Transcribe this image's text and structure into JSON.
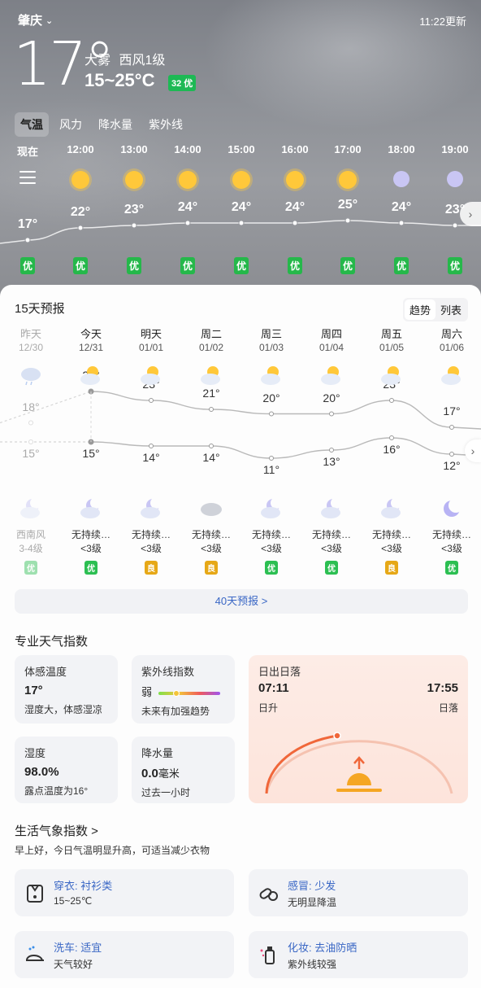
{
  "header": {
    "city": "肇庆",
    "update_time": "11:22更新",
    "current_temp": "17°",
    "condition": "大雾",
    "wind": "西风1级",
    "range": "15~25°C",
    "aqi": "32 优"
  },
  "tabs": [
    "气温",
    "风力",
    "降水量",
    "紫外线"
  ],
  "hourly": {
    "labels": [
      "现在",
      "12:00",
      "13:00",
      "14:00",
      "15:00",
      "16:00",
      "17:00",
      "18:00",
      "19:00"
    ],
    "icons": [
      "menu-icon",
      "sun-icon",
      "sun-icon",
      "sun-icon",
      "sun-icon",
      "sun-icon",
      "sun-icon",
      "moon-icon",
      "moon-icon"
    ],
    "temps": [
      "17°",
      "22°",
      "23°",
      "24°",
      "24°",
      "24°",
      "25°",
      "24°",
      "23°"
    ],
    "temp_values": [
      17,
      22,
      23,
      24,
      24,
      24,
      25,
      24,
      23
    ],
    "aqi": [
      "优",
      "优",
      "优",
      "优",
      "优",
      "优",
      "优",
      "优",
      "优"
    ]
  },
  "forecast": {
    "title": "15天预报",
    "toggle": [
      "趋势",
      "列表"
    ],
    "days": [
      {
        "name": "昨天",
        "date": "12/30",
        "day_icon": "cloud-rain-icon",
        "hi": "18°",
        "lo": "15°",
        "night_icon": "moon-cloud-icon",
        "wind1": "西南风",
        "wind2": "3-4级",
        "aqi": "优",
        "aqi_level": "good",
        "hi_value": 18,
        "lo_value": 15
      },
      {
        "name": "今天",
        "date": "12/31",
        "day_icon": "partly-sunny-icon",
        "hi": "25°",
        "lo": "15°",
        "night_icon": "moon-cloud-icon",
        "wind1": "无持续…",
        "wind2": "<3级",
        "aqi": "优",
        "aqi_level": "good",
        "hi_value": 25,
        "lo_value": 15
      },
      {
        "name": "明天",
        "date": "01/01",
        "day_icon": "partly-sunny-icon",
        "hi": "23°",
        "lo": "14°",
        "night_icon": "moon-cloud-icon",
        "wind1": "无持续…",
        "wind2": "<3级",
        "aqi": "良",
        "aqi_level": "ok",
        "hi_value": 23,
        "lo_value": 14
      },
      {
        "name": "周二",
        "date": "01/02",
        "day_icon": "partly-sunny-icon",
        "hi": "21°",
        "lo": "14°",
        "night_icon": "cloud-icon",
        "wind1": "无持续…",
        "wind2": "<3级",
        "aqi": "良",
        "aqi_level": "ok",
        "hi_value": 21,
        "lo_value": 14
      },
      {
        "name": "周三",
        "date": "01/03",
        "day_icon": "partly-sunny-icon",
        "hi": "20°",
        "lo": "11°",
        "night_icon": "moon-cloud-icon",
        "wind1": "无持续…",
        "wind2": "<3级",
        "aqi": "优",
        "aqi_level": "good",
        "hi_value": 20,
        "lo_value": 11
      },
      {
        "name": "周四",
        "date": "01/04",
        "day_icon": "partly-sunny-icon",
        "hi": "20°",
        "lo": "13°",
        "night_icon": "moon-cloud-icon",
        "wind1": "无持续…",
        "wind2": "<3级",
        "aqi": "优",
        "aqi_level": "good",
        "hi_value": 20,
        "lo_value": 13
      },
      {
        "name": "周五",
        "date": "01/05",
        "day_icon": "partly-sunny-icon",
        "hi": "23°",
        "lo": "16°",
        "night_icon": "moon-cloud-icon",
        "wind1": "无持续…",
        "wind2": "<3级",
        "aqi": "良",
        "aqi_level": "ok",
        "hi_value": 23,
        "lo_value": 16
      },
      {
        "name": "周六",
        "date": "01/06",
        "day_icon": "partly-sunny-icon",
        "hi": "17°",
        "lo": "12°",
        "night_icon": "moon-icon",
        "wind1": "无持续…",
        "wind2": "<3级",
        "aqi": "优",
        "aqi_level": "good",
        "hi_value": 17,
        "lo_value": 12
      }
    ],
    "more_label": "40天预报 >"
  },
  "pro": {
    "title": "专业天气指数",
    "feels": {
      "title": "体感温度",
      "value": "17°",
      "desc": "湿度大，体感湿凉"
    },
    "uv": {
      "title": "紫外线指数",
      "value": "弱",
      "desc": "未来有加强趋势"
    },
    "humidity": {
      "title": "湿度",
      "value": "98.0%",
      "desc": "露点温度为16°"
    },
    "rain": {
      "title": "降水量",
      "value": "0.0",
      "unit": "毫米",
      "desc": "过去一小时"
    },
    "sun": {
      "title": "日出日落",
      "sunrise": "07:11",
      "sunset": "17:55",
      "sunrise_label": "日升",
      "sunset_label": "日落"
    }
  },
  "life": {
    "title": "生活气象指数 >",
    "subtitle": "早上好，今日气温明显升高，可适当减少衣物",
    "items": [
      {
        "title": "穿衣: 衬衫类",
        "desc": "15~25℃",
        "icon": "shirt-icon"
      },
      {
        "title": "感冒: 少发",
        "desc": "无明显降温",
        "icon": "pills-icon"
      },
      {
        "title": "洗车: 适宜",
        "desc": "天气较好",
        "icon": "car-wash-icon"
      },
      {
        "title": "化妆: 去油防晒",
        "desc": "紫外线较强",
        "icon": "cosmetics-icon"
      }
    ]
  },
  "colors": {
    "aqi_good": "#25b84a",
    "aqi_ok": "#e6a817",
    "link": "#3a67c5",
    "sun_arc": "#f0673a"
  }
}
